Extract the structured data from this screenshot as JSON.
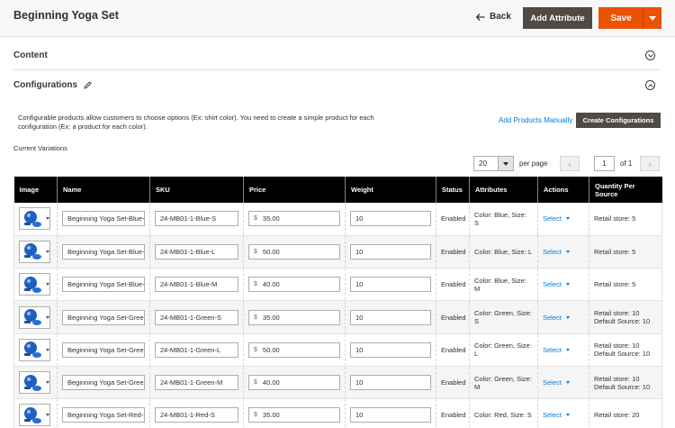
{
  "header": {
    "title": "Beginning Yoga Set",
    "back_label": "Back",
    "add_attribute_label": "Add Attribute",
    "save_label": "Save"
  },
  "sections": {
    "content_title": "Content",
    "configurations_title": "Configurations"
  },
  "configurations": {
    "intro": "Configurable products allow customers to choose options (Ex: shirt color). You need to create a simple product for each configuration (Ex: a product for each color).",
    "add_manually_label": "Add Products Manually",
    "create_label": "Create Configurations",
    "current_variations_label": "Current Variations"
  },
  "pager": {
    "per_page_value": "20",
    "per_page_label": "per page",
    "prev_symbol": "‹",
    "next_symbol": "›",
    "current_page": "1",
    "of_label": "of 1"
  },
  "table": {
    "headers": [
      "Image",
      "Name",
      "SKU",
      "Price",
      "Weight",
      "Status",
      "Attributes",
      "Actions",
      "Quantity Per Source"
    ],
    "currency_symbol": "$",
    "rows": [
      {
        "name": "Beginning Yoga Set-Blue-S",
        "sku": "24-MB01-1-Blue-S",
        "price": "35.00",
        "weight": "10",
        "status": "Enabled",
        "attributes": "Color: Blue, Size: S",
        "action": "Select",
        "qty_line1": "Retail store: 5",
        "qty_line2": ""
      },
      {
        "name": "Beginning Yoga Set-Blue-L",
        "sku": "24-MB01-1-Blue-L",
        "price": "50.00",
        "weight": "10",
        "status": "Enabled",
        "attributes": "Color: Blue, Size: L",
        "action": "Select",
        "qty_line1": "Retail store: 5",
        "qty_line2": ""
      },
      {
        "name": "Beginning Yoga Set-Blue-M",
        "sku": "24-MB01-1-Blue-M",
        "price": "40.00",
        "weight": "10",
        "status": "Enabled",
        "attributes": "Color: Blue, Size: M",
        "action": "Select",
        "qty_line1": "Retail store: 5",
        "qty_line2": ""
      },
      {
        "name": "Beginning Yoga Set-Green-S",
        "sku": "24-MB01-1-Green-S",
        "price": "35.00",
        "weight": "10",
        "status": "Enabled",
        "attributes": "Color: Green, Size: S",
        "action": "Select",
        "qty_line1": "Retail store: 10",
        "qty_line2": "Default Source: 10"
      },
      {
        "name": "Beginning Yoga Set-Green-L",
        "sku": "24-MB01-1-Green-L",
        "price": "50.00",
        "weight": "10",
        "status": "Enabled",
        "attributes": "Color: Green, Size: L",
        "action": "Select",
        "qty_line1": "Retail store: 10",
        "qty_line2": "Default Source: 10"
      },
      {
        "name": "Beginning Yoga Set-Green-M",
        "sku": "24-MB01-1-Green-M",
        "price": "40.00",
        "weight": "10",
        "status": "Enabled",
        "attributes": "Color: Green, Size: M",
        "action": "Select",
        "qty_line1": "Retail store: 10",
        "qty_line2": "Default Source: 10"
      },
      {
        "name": "Beginning Yoga Set-Red-S",
        "sku": "24-MB01-1-Red-S",
        "price": "35.00",
        "weight": "10",
        "status": "Enabled",
        "attributes": "Color: Red, Size: S",
        "action": "Select",
        "qty_line1": "Retail store: 20",
        "qty_line2": ""
      }
    ]
  },
  "colors": {
    "accent": "#eb5202",
    "dark_button": "#514943",
    "link": "#007bdb"
  },
  "icons": [
    "back-arrow-icon",
    "pencil-icon",
    "chevron-down-icon",
    "chevron-up-icon",
    "caret-down-icon",
    "product-thumbnail-icon"
  ]
}
